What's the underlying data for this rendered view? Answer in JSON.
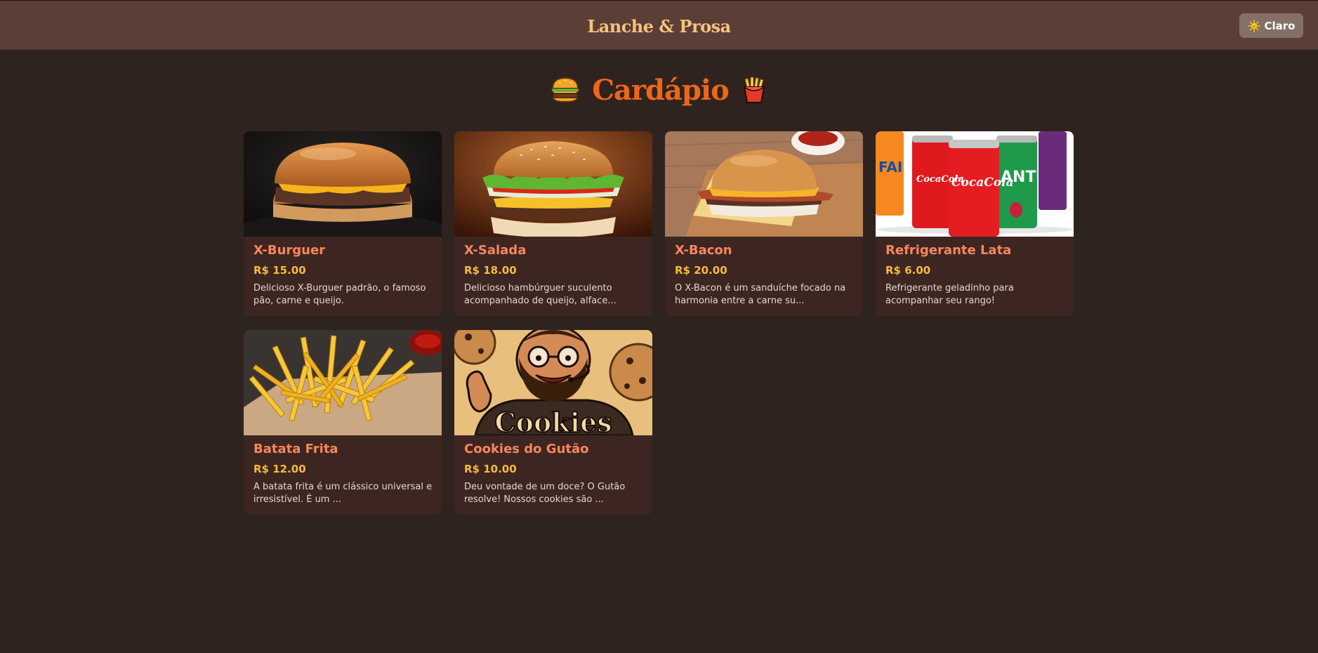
{
  "header": {
    "brand": "Lanche & Prosa",
    "theme_button_label": "Claro",
    "theme_icon": "sun-emoji"
  },
  "menu": {
    "title": "Cardápio",
    "title_left_icon": "hamburger-emoji",
    "title_right_icon": "fries-emoji",
    "items": [
      {
        "name": "X-Burguer",
        "price": "R$ 15.00",
        "description": "Delicioso X-Burguer padrão, o famoso pão, carne e queijo.",
        "image": "cheeseburger-photo"
      },
      {
        "name": "X-Salada",
        "price": "R$ 18.00",
        "description": "Delicioso hambúrguer suculento acompanhado de queijo, alface...",
        "image": "salad-burger-photo"
      },
      {
        "name": "X-Bacon",
        "price": "R$ 20.00",
        "description": "O X-Bacon é um sanduíche focado na harmonia entre a carne su...",
        "image": "bacon-burger-photo"
      },
      {
        "name": "Refrigerante Lata",
        "price": "R$ 6.00",
        "description": "Refrigerante geladinho para acompanhar seu rango!",
        "image": "soda-cans-photo"
      },
      {
        "name": "Batata Frita",
        "price": "R$ 12.00",
        "description": "A batata frita é um clássico universal e irresistível. É um ...",
        "image": "french-fries-photo"
      },
      {
        "name": "Cookies do Gutão",
        "price": "R$ 10.00",
        "description": "Deu vontade de um doce? O Gutão resolve! Nossos cookies são ...",
        "image": "cookies-cartoon-image",
        "image_text": "Cookies"
      }
    ]
  },
  "colors": {
    "background": "#2e231f",
    "topbar": "#5b3f37",
    "card": "#3d2621",
    "accent_orange": "#ef6618",
    "item_name": "#f8865d",
    "price": "#f5bb3d"
  }
}
